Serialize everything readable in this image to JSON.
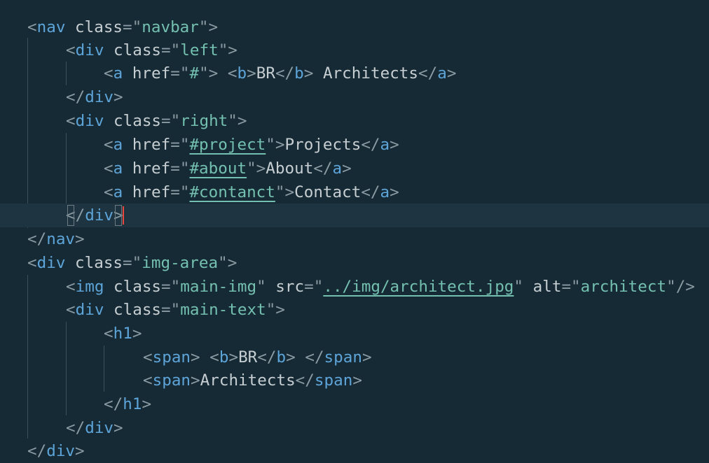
{
  "editor": {
    "language": "html",
    "active_line": 9,
    "colors": {
      "background": "#162a35",
      "active_line": "#1f3441",
      "tag": "#5da4d8",
      "punctuation": "#8a9ba3",
      "attribute": "#c6ced2",
      "string": "#74c0b0",
      "text": "#c6ced2",
      "cursor": "#e8473a"
    },
    "lines": [
      [
        "<",
        "nav",
        " class",
        "=\"",
        "navbar",
        "\">"
      ],
      [
        "<",
        "div",
        " class",
        "=\"",
        "left",
        "\">"
      ],
      [
        "<",
        "a",
        " href",
        "=\"",
        "#",
        "\">",
        " <",
        "b",
        ">",
        "BR",
        "</",
        "b",
        ">",
        " Architects",
        "</",
        "a",
        ">"
      ],
      [
        "</",
        "div",
        ">"
      ],
      [
        "<",
        "div",
        " class",
        "=\"",
        "right",
        "\">"
      ],
      [
        "<",
        "a",
        " href",
        "=\"",
        "#project",
        "\">",
        "Projects",
        "</",
        "a",
        ">"
      ],
      [
        "<",
        "a",
        " href",
        "=\"",
        "#about",
        "\">",
        "About",
        "</",
        "a",
        ">"
      ],
      [
        "<",
        "a",
        " href",
        "=\"",
        "#contanct",
        "\">",
        "Contact",
        "</",
        "a",
        ">"
      ],
      [
        "<",
        "/",
        "div",
        ">"
      ],
      [
        "</",
        "nav",
        ">"
      ],
      [
        "<",
        "div",
        " class",
        "=\"",
        "img-area",
        "\">"
      ],
      [
        "<",
        "img",
        " class",
        "=\"",
        "main-img",
        "\"",
        " src",
        "=\"",
        "../img/architect.jpg",
        "\"",
        " alt",
        "=\"",
        "architect",
        "\"/>"
      ],
      [
        "<",
        "div",
        " class",
        "=\"",
        "main-text",
        "\">"
      ],
      [
        "<",
        "h1",
        ">"
      ],
      [
        "<",
        "span",
        ">",
        " <",
        "b",
        ">",
        "BR",
        "</",
        "b",
        ">",
        " </",
        "span",
        ">"
      ],
      [
        "<",
        "span",
        ">",
        "Architects",
        "</",
        "span",
        ">"
      ],
      [
        "</",
        "h1",
        ">"
      ],
      [
        "</",
        "div",
        ">"
      ],
      [
        "</",
        "div",
        ">"
      ]
    ]
  }
}
